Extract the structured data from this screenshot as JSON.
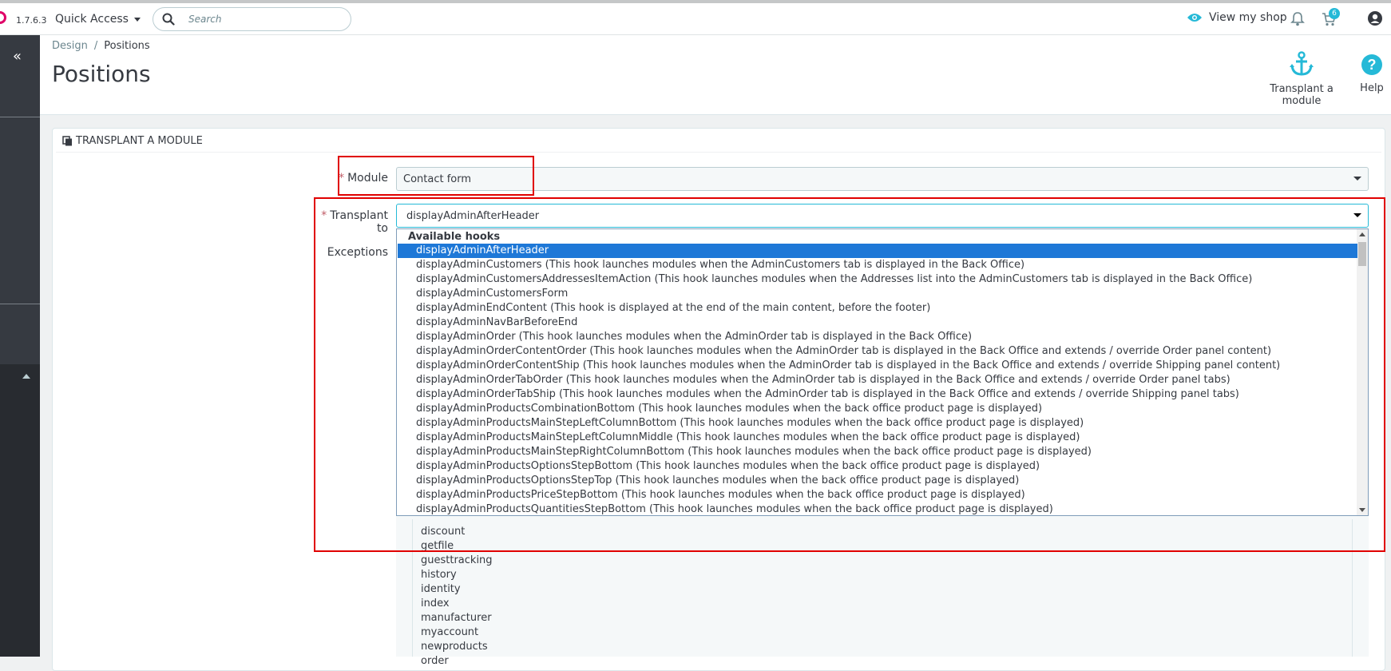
{
  "topbar": {
    "version": "1.7.6.3",
    "quick_access": "Quick Access",
    "search_placeholder": "Search",
    "view_shop": "View my shop",
    "orders_badge": "6"
  },
  "breadcrumb": {
    "parent": "Design",
    "separator": "/",
    "current": "Positions"
  },
  "page_title": "Positions",
  "toolbar": {
    "transplant_label": "Transplant a module",
    "help_label": "Help"
  },
  "panel": {
    "heading": "Transplant a module",
    "module_label": "Module",
    "module_value": "Contact form",
    "transplant_label": "Transplant to",
    "transplant_value": "displayAdminAfterHeader",
    "exceptions_label": "Exceptions"
  },
  "dropdown": {
    "group_label": "Available hooks",
    "options": [
      "displayAdminAfterHeader",
      "displayAdminCustomers (This hook launches modules when the AdminCustomers tab is displayed in the Back Office)",
      "displayAdminCustomersAddressesItemAction (This hook launches modules when the Addresses list into the AdminCustomers tab is displayed in the Back Office)",
      "displayAdminCustomersForm",
      "displayAdminEndContent (This hook is displayed at the end of the main content, before the footer)",
      "displayAdminNavBarBeforeEnd",
      "displayAdminOrder (This hook launches modules when the AdminOrder tab is displayed in the Back Office)",
      "displayAdminOrderContentOrder (This hook launches modules when the AdminOrder tab is displayed in the Back Office and extends / override Order panel content)",
      "displayAdminOrderContentShip (This hook launches modules when the AdminOrder tab is displayed in the Back Office and extends / override Shipping panel content)",
      "displayAdminOrderTabOrder (This hook launches modules when the AdminOrder tab is displayed in the Back Office and extends / override Order panel tabs)",
      "displayAdminOrderTabShip (This hook launches modules when the AdminOrder tab is displayed in the Back Office and extends / override Shipping panel tabs)",
      "displayAdminProductsCombinationBottom (This hook launches modules when the back office product page is displayed)",
      "displayAdminProductsMainStepLeftColumnBottom (This hook launches modules when the back office product page is displayed)",
      "displayAdminProductsMainStepLeftColumnMiddle (This hook launches modules when the back office product page is displayed)",
      "displayAdminProductsMainStepRightColumnBottom (This hook launches modules when the back office product page is displayed)",
      "displayAdminProductsOptionsStepBottom (This hook launches modules when the back office product page is displayed)",
      "displayAdminProductsOptionsStepTop (This hook launches modules when the back office product page is displayed)",
      "displayAdminProductsPriceStepBottom (This hook launches modules when the back office product page is displayed)",
      "displayAdminProductsQuantitiesStepBottom (This hook launches modules when the back office product page is displayed)"
    ]
  },
  "exceptions": [
    "discount",
    "getfile",
    "guesttracking",
    "history",
    "identity",
    "index",
    "manufacturer",
    "myaccount",
    "newproducts",
    "order"
  ],
  "colors": {
    "accent": "#25b9d7",
    "highlight": "#e00000",
    "selected": "#1e78d7"
  }
}
